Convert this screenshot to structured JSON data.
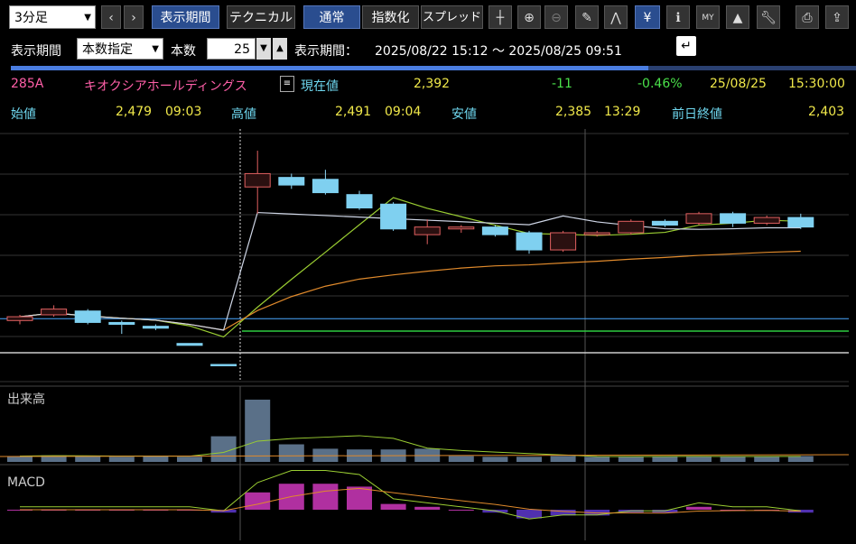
{
  "toolbar": {
    "interval": "3分足",
    "period_button": "表示期間",
    "technical_button": "テクニカル",
    "normal_button": "通常",
    "index_button": "指数化",
    "spread_button": "スプレッド",
    "icons": [
      "crosshair-icon",
      "zoom-in-icon",
      "zoom-out-icon",
      "pencil-icon",
      "chart-wave-icon",
      "yen-icon",
      "info-icon",
      "my-icon",
      "area-chart-icon",
      "wrench-icon",
      "print-icon",
      "export-icon"
    ]
  },
  "period_row": {
    "label_period": "表示期間",
    "mode": "本数指定",
    "label_count": "本数",
    "count": "25",
    "label_range": "表示期間：",
    "range": "2025/08/22 15:12 ～ 2025/08/25 09:51",
    "back_icon": "↵"
  },
  "progress": {
    "fraction": 0.754
  },
  "quote": {
    "code": "285A",
    "name": "キオクシアホールディングス",
    "current_label": "現在値",
    "current": "2,392",
    "change": "-11",
    "change_pct": "-0.46%",
    "date": "25/08/25",
    "time": "15:30:00",
    "open_label": "始値",
    "open": "2,479",
    "open_time": "09:03",
    "high_label": "高値",
    "high": "2,491",
    "high_time": "09:04",
    "low_label": "安値",
    "low": "2,385",
    "low_time": "13:29",
    "prev_close_label": "前日終値",
    "prev_close": "2,403"
  },
  "chart_data": {
    "type": "candlestick",
    "volume_label": "出来高",
    "macd_label": "MACD",
    "candles": [
      {
        "open": 2402,
        "close": 2404,
        "high": 2405,
        "low": 2400,
        "up": true
      },
      {
        "open": 2405,
        "close": 2408,
        "high": 2410,
        "low": 2404,
        "up": true
      },
      {
        "open": 2407,
        "close": 2401,
        "high": 2408,
        "low": 2400,
        "up": false
      },
      {
        "open": 2401,
        "close": 2400,
        "high": 2402,
        "low": 2395,
        "up": false
      },
      {
        "open": 2399,
        "close": 2398,
        "high": 2400,
        "low": 2397,
        "up": false
      },
      {
        "open": 2390,
        "close": 2389,
        "high": 2390,
        "low": 2389,
        "up": false
      },
      {
        "open": 2379,
        "close": 2379,
        "high": 2379,
        "low": 2379,
        "up": false
      },
      {
        "open": 2472,
        "close": 2479,
        "high": 2491,
        "low": 2458,
        "up": true
      },
      {
        "open": 2477,
        "close": 2473,
        "high": 2479,
        "low": 2471,
        "up": false
      },
      {
        "open": 2476,
        "close": 2469,
        "high": 2481,
        "low": 2468,
        "up": false
      },
      {
        "open": 2468,
        "close": 2461,
        "high": 2470,
        "low": 2460,
        "up": false
      },
      {
        "open": 2463,
        "close": 2450,
        "high": 2464,
        "low": 2449,
        "up": false
      },
      {
        "open": 2447,
        "close": 2451,
        "high": 2455,
        "low": 2442,
        "up": true
      },
      {
        "open": 2450,
        "close": 2451,
        "high": 2452,
        "low": 2448,
        "up": true
      },
      {
        "open": 2451,
        "close": 2447,
        "high": 2452,
        "low": 2446,
        "up": false
      },
      {
        "open": 2448,
        "close": 2439,
        "high": 2449,
        "low": 2437,
        "up": false
      },
      {
        "open": 2439,
        "close": 2448,
        "high": 2449,
        "low": 2438,
        "up": true
      },
      {
        "open": 2447,
        "close": 2448,
        "high": 2449,
        "low": 2446,
        "up": true
      },
      {
        "open": 2448,
        "close": 2454,
        "high": 2455,
        "low": 2447,
        "up": true
      },
      {
        "open": 2454,
        "close": 2452,
        "high": 2455,
        "low": 2451,
        "up": false
      },
      {
        "open": 2453,
        "close": 2458,
        "high": 2459,
        "low": 2452,
        "up": true
      },
      {
        "open": 2458,
        "close": 2453,
        "high": 2459,
        "low": 2451,
        "up": false
      },
      {
        "open": 2453,
        "close": 2456,
        "high": 2457,
        "low": 2452,
        "up": true
      },
      {
        "open": 2456,
        "close": 2451,
        "high": 2458,
        "low": 2450,
        "up": false
      }
    ],
    "volume": [
      8,
      9,
      8,
      7,
      8,
      7,
      35,
      85,
      24,
      18,
      17,
      17,
      18,
      8,
      7,
      7,
      8,
      7,
      7,
      8,
      8,
      7,
      7,
      8
    ],
    "macd": [
      0,
      0,
      0,
      0,
      0,
      0,
      -1,
      6,
      9,
      9,
      8,
      2,
      1,
      0,
      -1,
      -3,
      -2,
      -2,
      -1,
      -1,
      1,
      0,
      0,
      -1
    ]
  }
}
